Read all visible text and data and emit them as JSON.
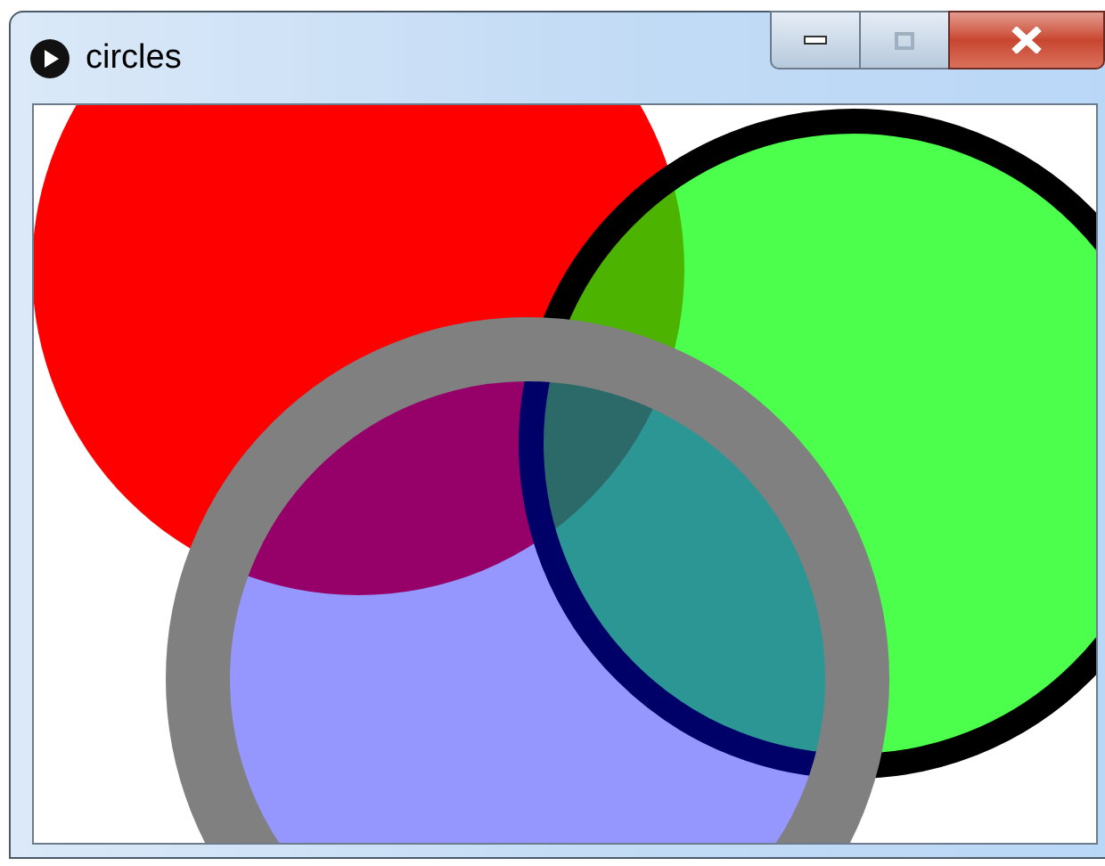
{
  "window": {
    "title": "circles"
  }
}
